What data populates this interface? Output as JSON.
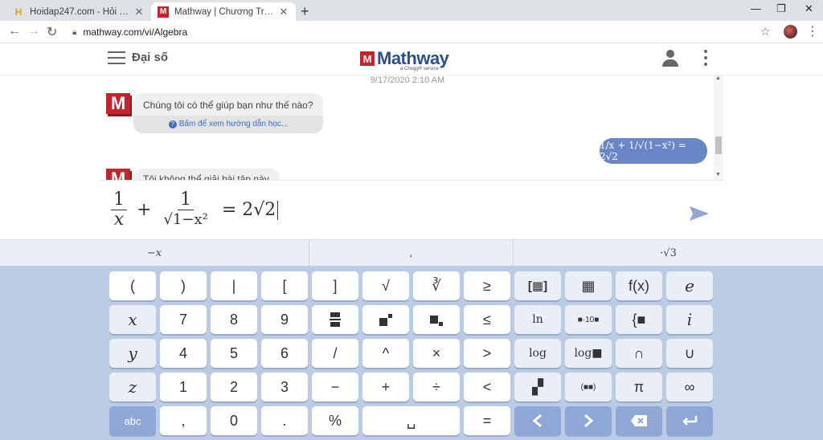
{
  "browser": {
    "tabs": [
      {
        "title": "Hoidap247.com - Hỏi đáp bài tập",
        "favicon": "H"
      },
      {
        "title": "Mathway | Chương Trình Giải Bài",
        "favicon": "M"
      }
    ],
    "url": "mathway.com/vi/Algebra"
  },
  "header": {
    "subject": "Đại số",
    "logo_mark": "M",
    "logo_text": "Mathway",
    "logo_sub": "a Chegg® service"
  },
  "chat": {
    "timestamp": "9/17/2020 2:10 AM",
    "bot_message": "Chúng tôi có thể giúp bạn như thế nào?",
    "bot_hint": "Bấm để xem hướng dẫn học...",
    "user_message": "1/x + 1/√(1−x²) = 2√2",
    "bot_message2": "Tôi không thể giải bài tập này"
  },
  "input": {
    "num1": "1",
    "den1": "x",
    "plus": "+",
    "num2": "1",
    "den2": "√1−x²",
    "rhs": "= 2√2"
  },
  "keyboard": {
    "suggestions": [
      "−x",
      ",",
      "·√3"
    ],
    "rows": [
      [
        "(",
        ")",
        "|",
        "[",
        "]",
        "√",
        "∛",
        "≥",
        "matrix",
        "matrix2",
        "f(x)",
        "e"
      ],
      [
        "x",
        "7",
        "8",
        "9",
        "frac",
        "pow",
        "sub",
        "≤",
        "ln",
        "■·10■",
        "{■",
        "i"
      ],
      [
        "y",
        "4",
        "5",
        "6",
        "/",
        "^",
        "×",
        ">",
        "log",
        "log■",
        "∩",
        "∪"
      ],
      [
        "z",
        "1",
        "2",
        "3",
        "−",
        "+",
        "÷",
        "<",
        "det",
        "(■■)",
        "π",
        "∞"
      ],
      [
        "abc",
        ",",
        "0",
        ".",
        "%",
        "␣",
        "=",
        "◀",
        "▶",
        "⌫",
        "↵"
      ]
    ]
  }
}
